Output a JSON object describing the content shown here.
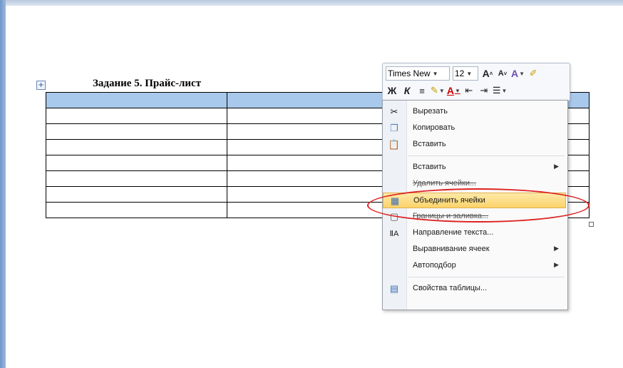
{
  "document": {
    "heading": "Задание 5. Прайс-лист",
    "table_rows": 8,
    "table_cols": 3
  },
  "mini_toolbar": {
    "font_name": "Times New",
    "font_size": "12"
  },
  "context_menu": {
    "items": [
      {
        "label": "Вырезать",
        "icon": "scissors-icon"
      },
      {
        "label": "Копировать",
        "icon": "copy-icon"
      },
      {
        "label": "Вставить",
        "icon": "paste-icon"
      },
      {
        "label": "Вставить",
        "submenu": true
      },
      {
        "label": "Удалить ячейки..."
      },
      {
        "label": "Объединить ячейки",
        "icon": "merge-cells-icon",
        "highlighted": true
      },
      {
        "label": "Границы и заливка...",
        "icon": "borders-icon"
      },
      {
        "label": "Направление текста...",
        "icon": "text-direction-icon"
      },
      {
        "label": "Выравнивание ячеек",
        "submenu": true
      },
      {
        "label": "Автоподбор",
        "submenu": true
      },
      {
        "label": "Свойства таблицы...",
        "icon": "table-properties-icon"
      }
    ]
  },
  "annotation": {
    "color": "#dd2222"
  }
}
